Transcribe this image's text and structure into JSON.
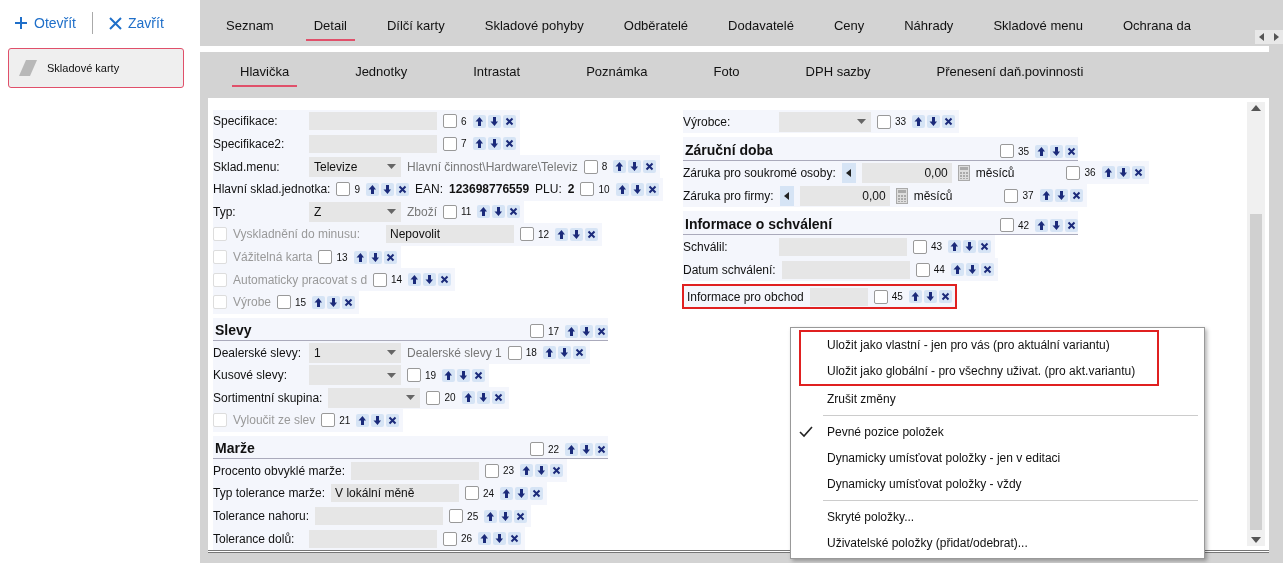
{
  "sidebar": {
    "open_button": "Otevřít",
    "close_button": "Zavřít",
    "items": [
      {
        "label": "Skladové karty",
        "selected": true
      }
    ]
  },
  "tabs": [
    {
      "label": "Seznam",
      "selected": false
    },
    {
      "label": "Detail",
      "selected": true
    },
    {
      "label": "Dílčí karty",
      "selected": false
    },
    {
      "label": "Skladové pohyby",
      "selected": false
    },
    {
      "label": "Odběratelé",
      "selected": false
    },
    {
      "label": "Dodavatelé",
      "selected": false
    },
    {
      "label": "Ceny",
      "selected": false
    },
    {
      "label": "Náhrady",
      "selected": false
    },
    {
      "label": "Skladové menu",
      "selected": false
    },
    {
      "label": "Ochrana da",
      "selected": false
    }
  ],
  "subtabs": [
    {
      "label": "Hlavička",
      "selected": true
    },
    {
      "label": "Jednotky",
      "selected": false
    },
    {
      "label": "Intrastat",
      "selected": false
    },
    {
      "label": "Poznámka",
      "selected": false
    },
    {
      "label": "Foto",
      "selected": false
    },
    {
      "label": "DPH sazby",
      "selected": false
    },
    {
      "label": "Přenesení daň.povinnosti",
      "selected": false
    }
  ],
  "form_left": [
    {
      "kind": "field",
      "label": "Specifikace:",
      "slot": {
        "number": "6",
        "checked": false
      }
    },
    {
      "kind": "field",
      "label": "Specifikace2:",
      "slot": {
        "number": "7",
        "checked": false
      }
    },
    {
      "kind": "combo",
      "label": "Sklad.menu:",
      "value": "Televize",
      "note": "Hlavní činnost\\Hardware\\Televiz",
      "slot": {
        "number": "8",
        "checked": false
      }
    },
    {
      "kind": "ean",
      "label": "Hlavní sklad.jednotka:",
      "slot": {
        "number": "9",
        "checked": false
      },
      "ean_label": "EAN:",
      "ean_value": "123698776559",
      "plu_label": "PLU:",
      "plu_value": "2",
      "slot2": {
        "number": "10",
        "checked": false
      }
    },
    {
      "kind": "combo",
      "label": "Typ:",
      "value": "Z",
      "note": "Zboží",
      "slot": {
        "number": "11",
        "checked": false
      }
    },
    {
      "kind": "checkbox",
      "label": "Vyskladnění do minusu:",
      "checked": false,
      "disabled": true,
      "value": "Nepovolit",
      "slot": {
        "number": "12",
        "checked": false
      }
    },
    {
      "kind": "checkbox",
      "label": "Vážitelná karta",
      "checked": false,
      "disabled": true,
      "slot": {
        "number": "13",
        "checked": false
      }
    },
    {
      "kind": "checkbox",
      "label": "Automaticky pracovat s d",
      "checked": false,
      "disabled": true,
      "slot": {
        "number": "14",
        "checked": false
      }
    },
    {
      "kind": "checkbox",
      "label": "Výrobe",
      "checked": false,
      "disabled": true,
      "slot": {
        "number": "15",
        "checked": false
      }
    },
    {
      "kind": "section",
      "label": "Slevy",
      "slot": {
        "number": "17",
        "checked": false
      }
    },
    {
      "kind": "combo",
      "label": "Dealerské slevy:",
      "value": "1",
      "note": "Dealerské slevy 1",
      "slot": {
        "number": "18",
        "checked": false
      }
    },
    {
      "kind": "combo",
      "label": "Kusové slevy:",
      "slot": {
        "number": "19",
        "checked": false
      }
    },
    {
      "kind": "combo",
      "label": "Sortimentní skupina:",
      "slot": {
        "number": "20",
        "checked": false
      }
    },
    {
      "kind": "checkbox",
      "label": "Vyloučit ze slev",
      "checked": false,
      "disabled": true,
      "slot": {
        "number": "21",
        "checked": false
      }
    },
    {
      "kind": "section",
      "label": "Marže",
      "slot": {
        "number": "22",
        "checked": false
      }
    },
    {
      "kind": "field",
      "label": "Procento obvyklé marže:",
      "slot": {
        "number": "23",
        "checked": false
      }
    },
    {
      "kind": "field",
      "label": "Typ tolerance marže:",
      "value": "V lokální měně",
      "slot": {
        "number": "24",
        "checked": false
      }
    },
    {
      "kind": "field",
      "label": "Tolerance nahoru:",
      "slot": {
        "number": "25",
        "checked": false
      }
    },
    {
      "kind": "field",
      "label": "Tolerance dolů:",
      "slot": {
        "number": "26",
        "checked": false
      }
    }
  ],
  "form_right": [
    {
      "kind": "combo",
      "label": "Výrobce:",
      "slot": {
        "number": "33",
        "checked": false
      }
    },
    {
      "kind": "section",
      "label": "Záruční doba",
      "slot": {
        "number": "35",
        "checked": false
      }
    },
    {
      "kind": "spin",
      "label": "Záruka pro soukromé osoby:",
      "value": "0,00",
      "unit": "měsíců",
      "slot": {
        "number": "36",
        "checked": false
      }
    },
    {
      "kind": "spin",
      "label": "Záruka pro firmy:",
      "value": "0,00",
      "unit": "měsíců",
      "slot": {
        "number": "37",
        "checked": false
      }
    },
    {
      "kind": "section",
      "label": "Informace o schválení",
      "slot": {
        "number": "42",
        "checked": false
      }
    },
    {
      "kind": "field",
      "label": "Schválil:",
      "slot": {
        "number": "43",
        "checked": false
      }
    },
    {
      "kind": "field",
      "label": "Datum schválení:",
      "slot": {
        "number": "44",
        "checked": false
      }
    },
    {
      "kind": "field",
      "label": "Informace pro obchod",
      "highlighted": true,
      "slot": {
        "number": "45",
        "checked": false
      }
    }
  ],
  "context_menu": [
    {
      "kind": "item",
      "label": "Uložit jako vlastní - jen pro vás (pro aktuální variantu)",
      "checked": false,
      "highlighted": true
    },
    {
      "kind": "item",
      "label": "Uložit jako globální - pro všechny uživat. (pro akt.variantu)",
      "checked": false,
      "highlighted": true
    },
    {
      "kind": "item",
      "label": "Zrušit změny",
      "checked": false,
      "highlighted": false
    },
    {
      "kind": "separator"
    },
    {
      "kind": "item",
      "label": "Pevné pozice položek",
      "checked": true,
      "highlighted": false
    },
    {
      "kind": "item",
      "label": "Dynamicky umísťovat položky - jen v editaci",
      "checked": false,
      "highlighted": false
    },
    {
      "kind": "item",
      "label": "Dynamicky umísťovat položky - vždy",
      "checked": false,
      "highlighted": false
    },
    {
      "kind": "separator"
    },
    {
      "kind": "item",
      "label": "Skryté položky...",
      "checked": false,
      "highlighted": false
    },
    {
      "kind": "item",
      "label": "Uživatelské položky (přidat/odebrat)...",
      "checked": false,
      "highlighted": false
    }
  ]
}
